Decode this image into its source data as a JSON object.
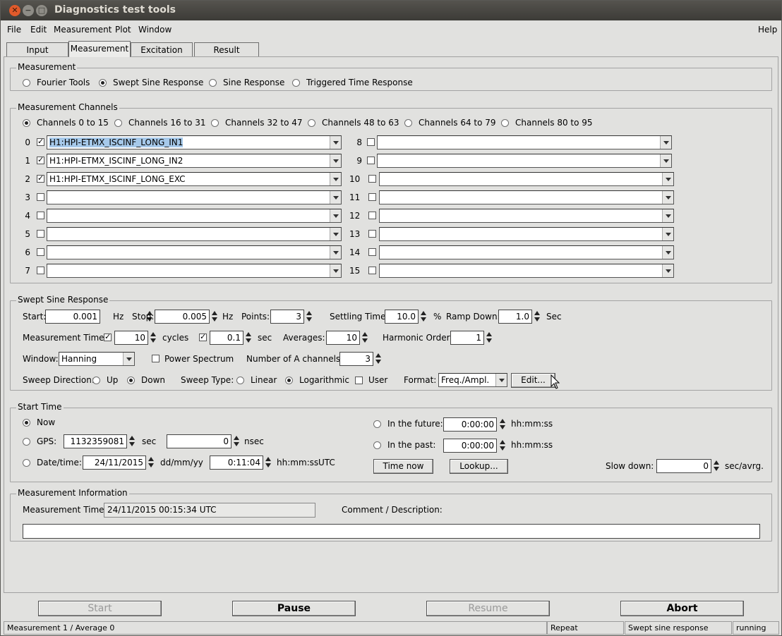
{
  "window": {
    "title": "Diagnostics test tools"
  },
  "menu": {
    "file": "File",
    "edit": "Edit",
    "measurement": "Measurement",
    "plot": "Plot",
    "window": "Window",
    "help": "Help"
  },
  "tabs": [
    "Input",
    "Measurement",
    "Excitation",
    "Result"
  ],
  "measurement": {
    "group": "Measurement",
    "options": [
      "Fourier Tools",
      "Swept Sine Response",
      "Sine Response",
      "Triggered Time Response"
    ]
  },
  "channels": {
    "group": "Measurement Channels",
    "ranges": [
      "Channels 0 to 15",
      "Channels 16 to 31",
      "Channels 32 to 47",
      "Channels 48 to 63",
      "Channels 64 to 79",
      "Channels 80 to 95"
    ],
    "left": [
      {
        "num": "0",
        "name": "H1:HPI-ETMX_ISCINF_LONG_IN1",
        "checked": true
      },
      {
        "num": "1",
        "name": "H1:HPI-ETMX_ISCINF_LONG_IN2",
        "checked": true
      },
      {
        "num": "2",
        "name": "H1:HPI-ETMX_ISCINF_LONG_EXC",
        "checked": true
      },
      {
        "num": "3",
        "name": "",
        "checked": false
      },
      {
        "num": "4",
        "name": "",
        "checked": false
      },
      {
        "num": "5",
        "name": "",
        "checked": false
      },
      {
        "num": "6",
        "name": "",
        "checked": false
      },
      {
        "num": "7",
        "name": "",
        "checked": false
      }
    ],
    "right": [
      {
        "num": "8",
        "name": "",
        "checked": false
      },
      {
        "num": "9",
        "name": "",
        "checked": false
      },
      {
        "num": "10",
        "name": "",
        "checked": false
      },
      {
        "num": "11",
        "name": "",
        "checked": false
      },
      {
        "num": "12",
        "name": "",
        "checked": false
      },
      {
        "num": "13",
        "name": "",
        "checked": false
      },
      {
        "num": "14",
        "name": "",
        "checked": false
      },
      {
        "num": "15",
        "name": "",
        "checked": false
      }
    ]
  },
  "swept": {
    "group": "Swept Sine Response",
    "start_label": "Start:",
    "start": "0.001",
    "hz1": "Hz",
    "stop_label": "Stop:",
    "stop": "0.005",
    "hz2": "Hz",
    "points_label": "Points:",
    "points": "3",
    "settling_label": "Settling Time:",
    "settling": "10.0",
    "pct": "%",
    "ramp_label": "Ramp Down:",
    "ramp": "1.0",
    "sec": "Sec",
    "mtime_label": "Measurement Time:",
    "cycles": "10",
    "cycles_label": "cycles",
    "secval": "0.1",
    "sec_label": "sec",
    "averages_label": "Averages:",
    "averages": "10",
    "harmonic_label": "Harmonic Order:",
    "harmonic": "1",
    "window_label": "Window:",
    "window": "Hanning",
    "power_label": "Power Spectrum",
    "nach_label": "Number of A channels:",
    "nach": "3",
    "dir_label": "Sweep Direction:",
    "up": "Up",
    "down": "Down",
    "type_label": "Sweep Type:",
    "linear": "Linear",
    "log": "Logarithmic",
    "user": "User",
    "format_label": "Format:",
    "format": "Freq./Ampl.",
    "edit": "Edit..."
  },
  "start_time": {
    "group": "Start Time",
    "now": "Now",
    "gps": "GPS:",
    "gps_sec": "1132359081",
    "sec": "sec",
    "gps_nsec": "0",
    "nsec": "nsec",
    "datetime": "Date/time:",
    "date": "24/11/2015",
    "date_fmt": "dd/mm/yy",
    "time": "0:11:04",
    "time_fmt": "hh:mm:ss",
    "utc": "UTC",
    "future": "In the future:",
    "future_val": "0:00:00",
    "future_fmt": "hh:mm:ss",
    "past": "In the past:",
    "past_val": "0:00:00",
    "past_fmt": "hh:mm:ss",
    "time_now": "Time now",
    "lookup": "Lookup...",
    "slow_label": "Slow down:",
    "slow": "0",
    "slow_unit": "sec/avrg."
  },
  "info": {
    "group": "Measurement Information",
    "mtime_label": "Measurement Time:",
    "mtime": "24/11/2015 00:15:34  UTC",
    "comment_label": "Comment / Description:",
    "comment": ""
  },
  "buttons": {
    "start": "Start",
    "pause": "Pause",
    "resume": "Resume",
    "abort": "Abort"
  },
  "status": {
    "left": "Measurement 1 / Average 0",
    "repeat": "Repeat",
    "mode": "Swept sine response",
    "state": "running"
  }
}
